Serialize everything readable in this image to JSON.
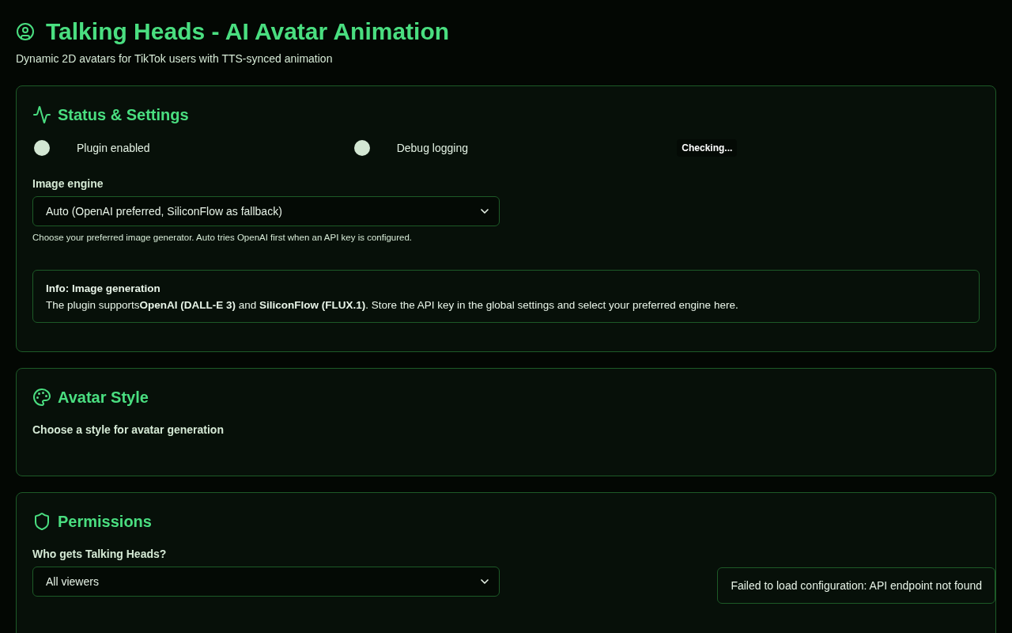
{
  "header": {
    "title": "Talking Heads - AI Avatar Animation",
    "subtitle": "Dynamic 2D avatars for TikTok users with TTS-synced animation"
  },
  "sections": [
    {
      "kind": "status",
      "title": "Status & Settings",
      "toggles": [
        {
          "label": "Plugin enabled",
          "on": false
        },
        {
          "label": "Debug logging",
          "on": false
        }
      ],
      "connection_status": "Checking...",
      "select": {
        "label": "Image engine",
        "value": "Auto (OpenAI preferred, SiliconFlow as fallback)",
        "hint": "Choose your preferred image generator. Auto tries OpenAI first when an API key is configured."
      },
      "info": {
        "title": "Info: Image generation",
        "text": "The plugin supports**OpenAI (DALL-E 3)** and **SiliconFlow (FLUX.1)**. Store the API key in the global settings and select your preferred engine here."
      }
    },
    {
      "kind": "style",
      "title": "Avatar Style",
      "label": "Choose a style for avatar generation"
    },
    {
      "kind": "permissions",
      "title": "Permissions",
      "select": {
        "label": "Who gets Talking Heads?",
        "value": "All viewers"
      }
    }
  ],
  "toast": {
    "message": "Failed to load configuration: API endpoint not found"
  }
}
